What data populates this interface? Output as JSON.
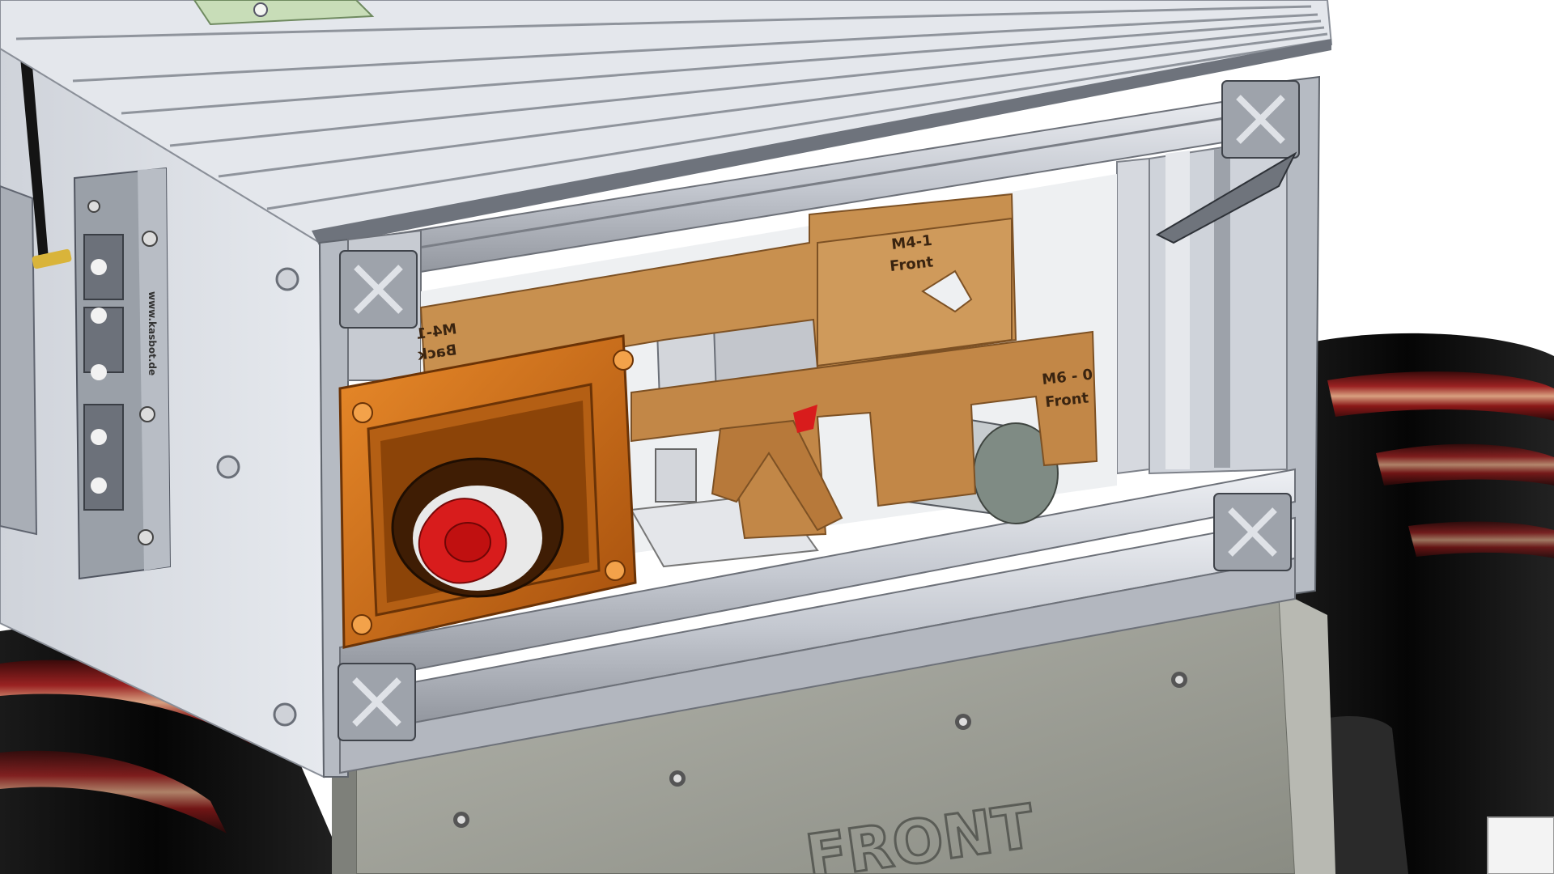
{
  "scene": {
    "subject": "robot chassis CAD model",
    "colors": {
      "background": "#ffffff",
      "aluminum": "#c9cdd6",
      "aluminum_dark": "#8d929c",
      "side_panel": "#d9dde3",
      "wood": "#c8904f",
      "wood_dark": "#9c6a34",
      "fan_housing": "#d4731c",
      "fan_red": "#d81c1c",
      "wheel": "#0c0c0c",
      "wheel_stripe": "#8e1a1a",
      "gray_box": "#9a9c92",
      "green_part": "#c8ddb8"
    }
  },
  "labels": {
    "board_top_left": "M4-1",
    "board_top_left_sub": "Back",
    "board_top_right": "M4-1",
    "board_top_right_sub": "Front",
    "board_mid_right": "M6 - 0",
    "board_mid_right_sub": "Front",
    "connector_panel_text": "www.kasbot.de",
    "front_box_text": "FRONT"
  }
}
